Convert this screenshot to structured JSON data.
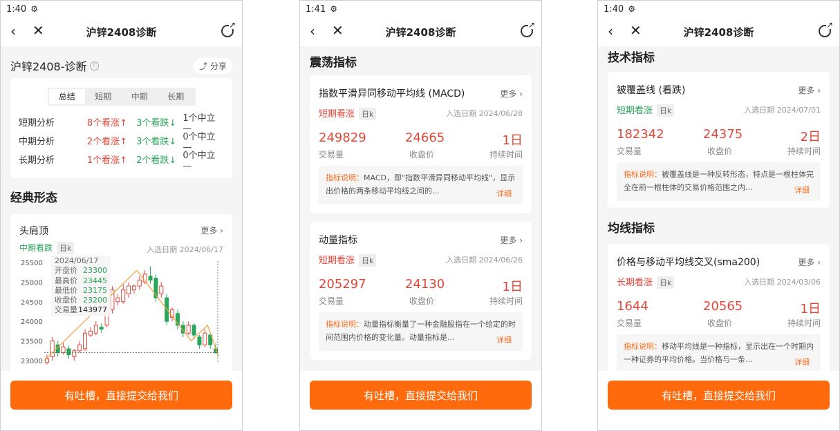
{
  "header": {
    "title": "沪锌2408诊断"
  },
  "phone1": {
    "time": "1:40",
    "summary_title": "沪锌2408-诊断",
    "help_icon": "question-icon",
    "share_label": "分享",
    "tabs": [
      "总结",
      "短期",
      "中期",
      "长期"
    ],
    "rows": [
      {
        "name": "短期分析",
        "up": "8个看涨↑",
        "down": "3个看跌↓",
        "mid": "1个中立—"
      },
      {
        "name": "中期分析",
        "up": "2个看涨↑",
        "down": "3个看跌↓",
        "mid": "0个中立—"
      },
      {
        "name": "长期分析",
        "up": "1个看涨↑",
        "down": "2个看跌↓",
        "mid": "0个中立—"
      }
    ],
    "section_classic": "经典形态",
    "pattern": {
      "name": "头肩顶",
      "more": "更多",
      "tag": "中期看跌",
      "period": "日k",
      "date": "入选日期  2024/06/17"
    },
    "tooltip": {
      "date": "2024/06/17",
      "open_label": "开盘价",
      "open": "23300",
      "high_label": "最高价",
      "high": "23445",
      "low_label": "最低价",
      "low": "23175",
      "close_label": "收盘价",
      "close": "23200",
      "vol_label": "交易量",
      "vol": "143977"
    },
    "chart_data": {
      "type": "candlestick",
      "y_ticks": [
        "25500",
        "25000",
        "24500",
        "24000",
        "23500",
        "23000"
      ],
      "ylim": [
        23000,
        25500
      ],
      "candles": [
        {
          "o": 22950,
          "c": 23050,
          "h": 23150,
          "l": 22900,
          "up": true
        },
        {
          "o": 23100,
          "c": 23500,
          "h": 23600,
          "l": 23000,
          "up": true
        },
        {
          "o": 23400,
          "c": 23200,
          "h": 23500,
          "l": 23100,
          "up": false
        },
        {
          "o": 23200,
          "c": 23350,
          "h": 23450,
          "l": 23150,
          "up": true
        },
        {
          "o": 23300,
          "c": 23150,
          "h": 23380,
          "l": 23050,
          "up": false
        },
        {
          "o": 23100,
          "c": 23250,
          "h": 23300,
          "l": 23000,
          "up": true
        },
        {
          "o": 23250,
          "c": 23400,
          "h": 23500,
          "l": 23200,
          "up": true
        },
        {
          "o": 23300,
          "c": 23700,
          "h": 23800,
          "l": 23250,
          "up": true
        },
        {
          "o": 23650,
          "c": 23750,
          "h": 23850,
          "l": 23600,
          "up": true
        },
        {
          "o": 23700,
          "c": 23900,
          "h": 24000,
          "l": 23650,
          "up": true
        },
        {
          "o": 23850,
          "c": 23800,
          "h": 23950,
          "l": 23700,
          "up": false
        },
        {
          "o": 23900,
          "c": 24300,
          "h": 24600,
          "l": 23850,
          "up": true
        },
        {
          "o": 24300,
          "c": 24800,
          "h": 24900,
          "l": 24200,
          "up": true
        },
        {
          "o": 24500,
          "c": 24600,
          "h": 24700,
          "l": 24400,
          "up": true
        },
        {
          "o": 24500,
          "c": 24800,
          "h": 24950,
          "l": 24450,
          "up": true
        },
        {
          "o": 24700,
          "c": 24900,
          "h": 25000,
          "l": 24600,
          "up": true
        },
        {
          "o": 24800,
          "c": 24900,
          "h": 24950,
          "l": 24700,
          "up": true
        },
        {
          "o": 24900,
          "c": 25050,
          "h": 25150,
          "l": 24800,
          "up": true
        },
        {
          "o": 25000,
          "c": 25200,
          "h": 25300,
          "l": 24950,
          "up": true
        },
        {
          "o": 25150,
          "c": 25050,
          "h": 25400,
          "l": 24950,
          "up": false
        },
        {
          "o": 25100,
          "c": 24600,
          "h": 25200,
          "l": 24500,
          "up": false
        },
        {
          "o": 24700,
          "c": 24900,
          "h": 25000,
          "l": 24600,
          "up": true
        },
        {
          "o": 24600,
          "c": 24000,
          "h": 24700,
          "l": 23900,
          "up": false
        },
        {
          "o": 24100,
          "c": 24300,
          "h": 24350,
          "l": 24000,
          "up": true
        },
        {
          "o": 24200,
          "c": 23900,
          "h": 24300,
          "l": 23800,
          "up": false
        },
        {
          "o": 23900,
          "c": 23700,
          "h": 24000,
          "l": 23600,
          "up": false
        },
        {
          "o": 23700,
          "c": 23900,
          "h": 24000,
          "l": 23650,
          "up": true
        },
        {
          "o": 23900,
          "c": 23650,
          "h": 23950,
          "l": 23550,
          "up": false
        },
        {
          "o": 23600,
          "c": 23400,
          "h": 23650,
          "l": 23300,
          "up": false
        },
        {
          "o": 23400,
          "c": 23700,
          "h": 23800,
          "l": 23350,
          "up": true
        },
        {
          "o": 23650,
          "c": 23400,
          "h": 23700,
          "l": 23300,
          "up": false
        },
        {
          "o": 23300,
          "c": 23200,
          "h": 23445,
          "l": 23175,
          "up": false
        }
      ]
    },
    "cta": "有吐槽，直接提交给我们"
  },
  "phone2": {
    "time": "1:41",
    "section": "震荡指标",
    "cards": [
      {
        "title": "指数平滑异同移动平均线 (MACD)",
        "more": "更多",
        "tag": "短期看涨",
        "period": "日k",
        "date": "入选日期  2024/06/28",
        "v1": "249829",
        "v2": "24665",
        "v3": "1日",
        "l1": "交易量",
        "l2": "收盘价",
        "l3": "持续时间",
        "note_label": "指标说明：",
        "note": "MACD，即\"指数平滑异同移动平均线\"，显示出价格的两条移动平均线之间的...",
        "detail": "详细"
      },
      {
        "title": "动量指标",
        "more": "更多",
        "tag": "短期看涨",
        "period": "日k",
        "date": "入选日期  2024/06/26",
        "v1": "205297",
        "v2": "24130",
        "v3": "1日",
        "l1": "交易量",
        "l2": "收盘价",
        "l3": "持续时间",
        "note_label": "指标说明：",
        "note": "动量指标衡量了一种金融股指在一个给定的时间范围内价格的变化量。动量指标是...",
        "detail": "详细"
      }
    ],
    "cta": "有吐槽，直接提交给我们"
  },
  "phone3": {
    "time": "1:40",
    "section_tech": "技术指标",
    "section_ma": "均线指标",
    "cards": [
      {
        "title": "被覆盖线 (看跌)",
        "more": "更多",
        "tag": "短期看涨",
        "period": "日k",
        "date": "入选日期  2024/07/01",
        "v1": "182342",
        "v2": "24375",
        "v3": "2日",
        "l1": "交易量",
        "l2": "收盘价",
        "l3": "持续时间",
        "note_label": "指标说明：",
        "note": "被覆盖线是一种反转形态，特点是一根柱体完全在前一根柱体的交易价格范围之内...",
        "detail": "详细"
      },
      {
        "title": "价格与移动平均线交叉(sma200)",
        "more": "更多",
        "tag": "长期看涨",
        "period": "日k",
        "date": "入选日期  2024/03/06",
        "v1": "1644",
        "v2": "20565",
        "v3": "1日",
        "l1": "交易量",
        "l2": "收盘价",
        "l3": "持续时间",
        "note_label": "指标说明：",
        "note": "移动平均线是一种指标，显示出在一个时期内一种证券的平均价格。当价格与一条...",
        "detail": "详细"
      }
    ],
    "cta": "有吐槽，直接提交给我们"
  }
}
